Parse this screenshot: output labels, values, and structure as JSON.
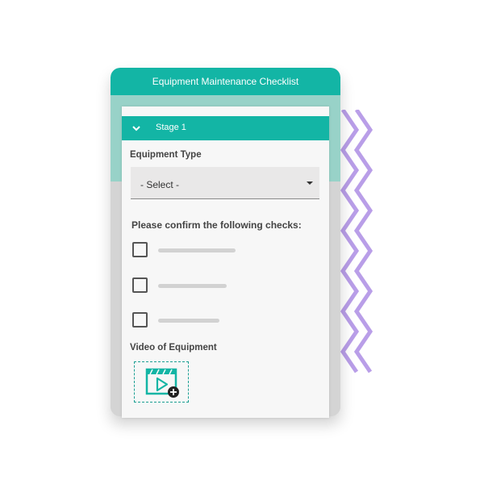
{
  "card": {
    "title": "Equipment Maintenance Checklist"
  },
  "stage": {
    "label": "Stage 1",
    "expanded": true
  },
  "equipment_type": {
    "label": "Equipment Type",
    "selected": "- Select -"
  },
  "checks": {
    "label": "Please confirm the following checks:",
    "items": [
      {
        "checked": false
      },
      {
        "checked": false
      },
      {
        "checked": false
      }
    ]
  },
  "video": {
    "label": "Video of Equipment"
  },
  "colors": {
    "accent": "#13b5a5",
    "accent_light": "#98d2c8",
    "zigzag": "#b99ee8"
  },
  "icons": {
    "stage_toggle": "chevron-down-icon",
    "select_arrow": "caret-down-icon",
    "video_upload": "video-add-icon"
  }
}
